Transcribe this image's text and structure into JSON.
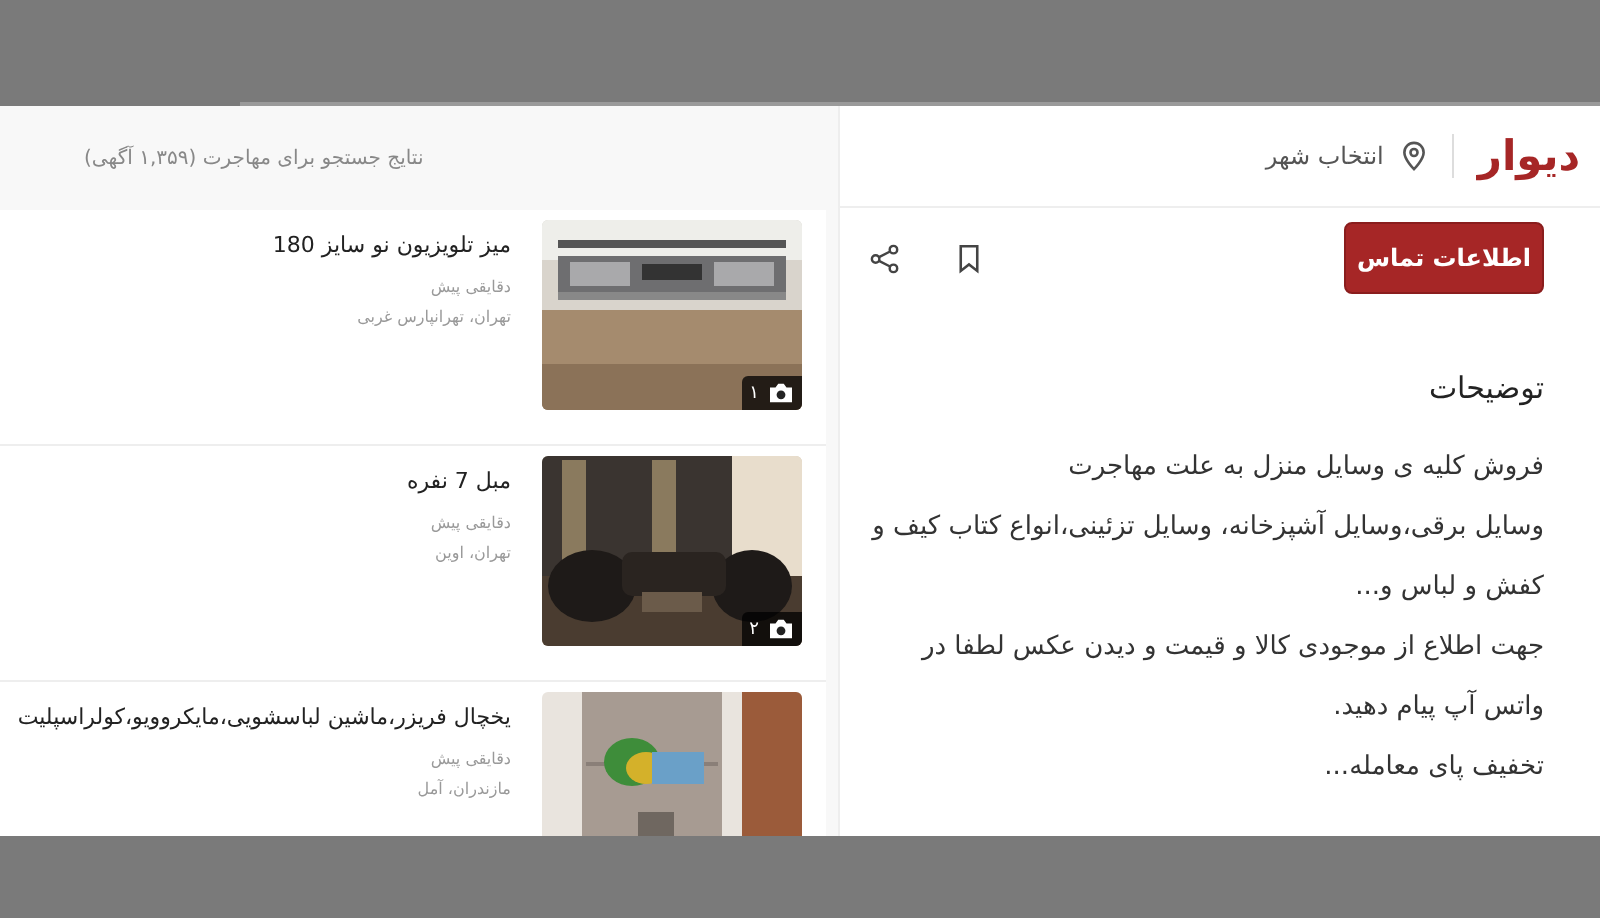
{
  "search_results": {
    "summary": "نتایج جستجو برای مهاجرت (۱,۳۵۹ آگهی)",
    "listings": [
      {
        "title": "میز تلویزیون نو سایز 180",
        "time": "دقایقی پیش",
        "location": "تهران، تهرانپارس غربی",
        "photo_count": "۱"
      },
      {
        "title": "مبل 7 نفره",
        "time": "دقایقی پیش",
        "location": "تهران، اوین",
        "photo_count": "۲"
      },
      {
        "title": "یخچال فریزر،ماشین لباسشویی،مایکروویو،کولراسپلیت",
        "time": "دقایقی پیش",
        "location": "مازندران، آمل"
      }
    ]
  },
  "header": {
    "logo": "دیوار",
    "city_button": "انتخاب شهر"
  },
  "ad_detail": {
    "contact_button": "اطلاعات تماس",
    "description_title": "توضیحات",
    "description": [
      "فروش کلیه ی وسایل منزل به علت مهاجرت",
      "وسایل برقی،وسایل آشپزخانه، وسایل تزئینی،انواع کتاب کیف و کفش و لباس و...",
      "جهت اطلاع از موجودی کالا و قیمت و دیدن عکس لطفا در واتس آپ پیام دهید.",
      "تخفیف پای معامله..."
    ]
  }
}
